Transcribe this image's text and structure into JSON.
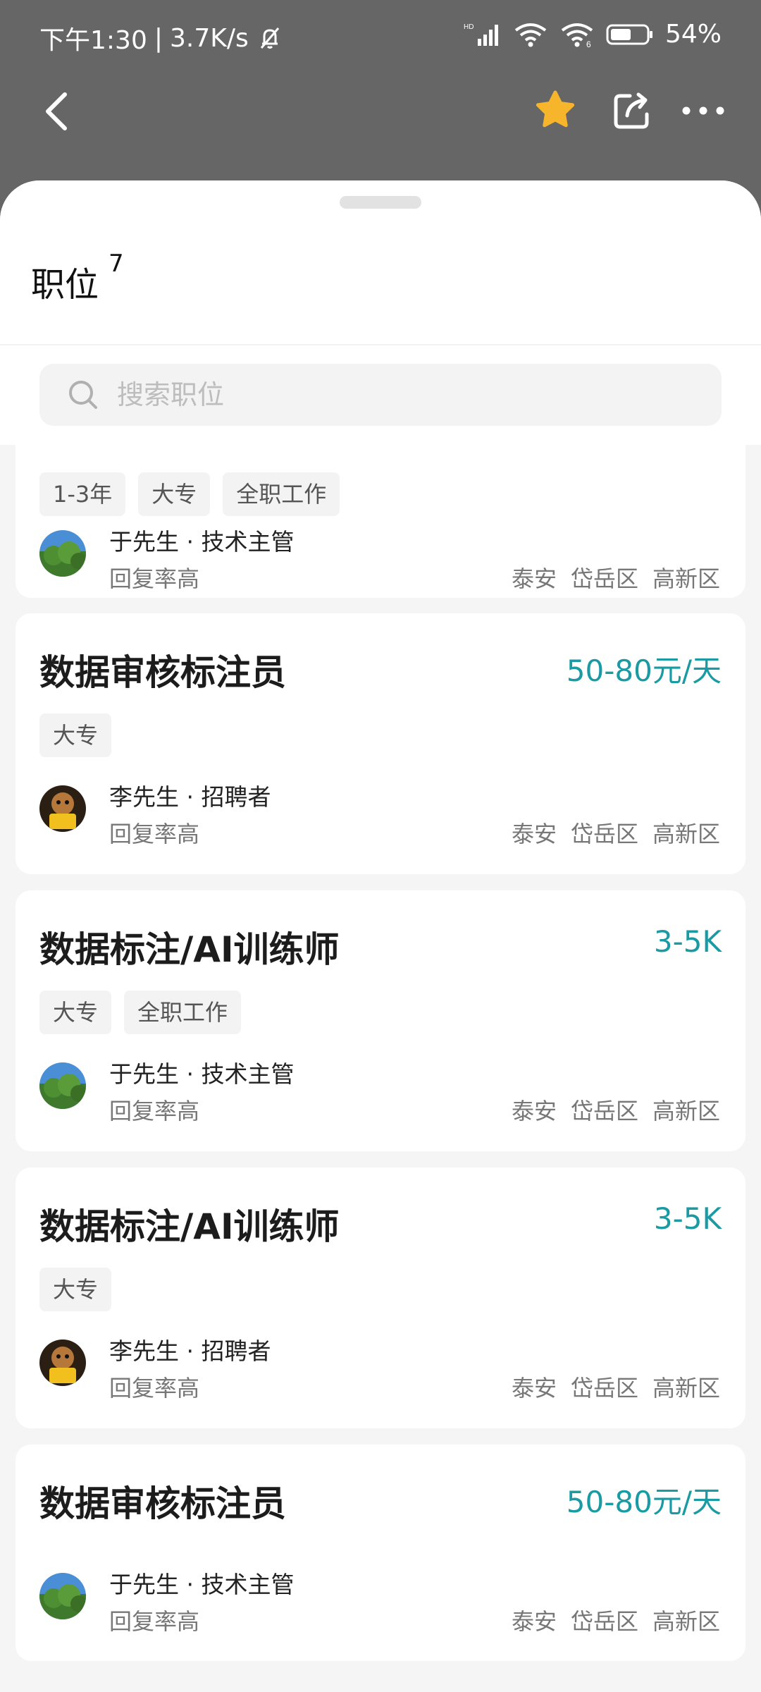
{
  "status_bar": {
    "time": "下午1:30",
    "speed": "3.7K/s",
    "battery": "54%"
  },
  "nav": {
    "icons": [
      "back-icon",
      "star-icon",
      "share-icon",
      "more-icon"
    ],
    "favorited": true,
    "star_color": "#f7b52c"
  },
  "sheet": {
    "title": "职位",
    "count": "7",
    "search_placeholder": "搜索职位"
  },
  "accent_color": "#1a9aa3",
  "jobs": [
    {
      "title": "",
      "salary": "",
      "tags": [
        "1-3年",
        "大专",
        "全职工作"
      ],
      "recruiter": "于先生 · 技术主管",
      "reply": "回复率高",
      "city": "泰安",
      "district": "岱岳区",
      "area": "高新区",
      "avatar": "landscape"
    },
    {
      "title": "数据审核标注员",
      "salary": "50-80元/天",
      "tags": [
        "大专"
      ],
      "recruiter": "李先生 · 招聘者",
      "reply": "回复率高",
      "city": "泰安",
      "district": "岱岳区",
      "area": "高新区",
      "avatar": "cartoon"
    },
    {
      "title": "数据标注/AI训练师",
      "salary": "3-5K",
      "tags": [
        "大专",
        "全职工作"
      ],
      "recruiter": "于先生 · 技术主管",
      "reply": "回复率高",
      "city": "泰安",
      "district": "岱岳区",
      "area": "高新区",
      "avatar": "landscape"
    },
    {
      "title": "数据标注/AI训练师",
      "salary": "3-5K",
      "tags": [
        "大专"
      ],
      "recruiter": "李先生 · 招聘者",
      "reply": "回复率高",
      "city": "泰安",
      "district": "岱岳区",
      "area": "高新区",
      "avatar": "cartoon"
    },
    {
      "title": "数据审核标注员",
      "salary": "50-80元/天",
      "tags": [],
      "recruiter": "于先生 · 技术主管",
      "reply": "回复率高",
      "city": "泰安",
      "district": "岱岳区",
      "area": "高新区",
      "avatar": "landscape"
    }
  ]
}
